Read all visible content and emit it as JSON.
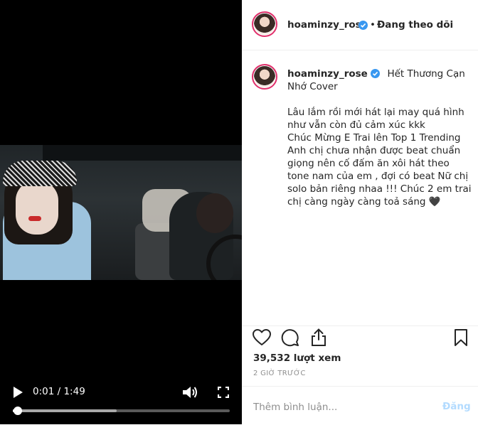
{
  "video": {
    "time_current": "0:01",
    "time_total": "1:49",
    "progress": 0.01,
    "buffered": 0.48
  },
  "header": {
    "username": "hoaminzy_rose",
    "separator": "•",
    "follow_label": "Đang theo dõi"
  },
  "caption": {
    "username": "hoaminzy_rose",
    "title_part1": "Hết Thương Cạn",
    "title_part2": "Nhớ Cover",
    "body": "Lâu lắm rồi mới hát lại may quá hình như vẫn còn đủ cảm xúc kkk\nChúc Mừng E Trai lên Top 1 Trending Anh chị chưa nhận được beat chuẩn giọng nên cố đấm ăn xôi hát theo tone nam của em , đợi có beat Nữ chị solo bản riêng nhaa !!! Chúc 2 em trai chị càng ngày càng toả sáng 🖤"
  },
  "stats": {
    "views": "39,532 lượt xem",
    "time_ago": "2 GIỜ TRƯỚC"
  },
  "comment": {
    "placeholder": "Thêm bình luận...",
    "post_label": "Đăng"
  },
  "colors": {
    "verified": "#3897f0",
    "post_disabled": "#b3dbff",
    "story_ring": "#e1306c"
  },
  "icons": [
    "play-icon",
    "volume-icon",
    "fullscreen-icon",
    "verified-icon",
    "heart-icon",
    "comment-icon",
    "share-icon",
    "bookmark-icon"
  ]
}
